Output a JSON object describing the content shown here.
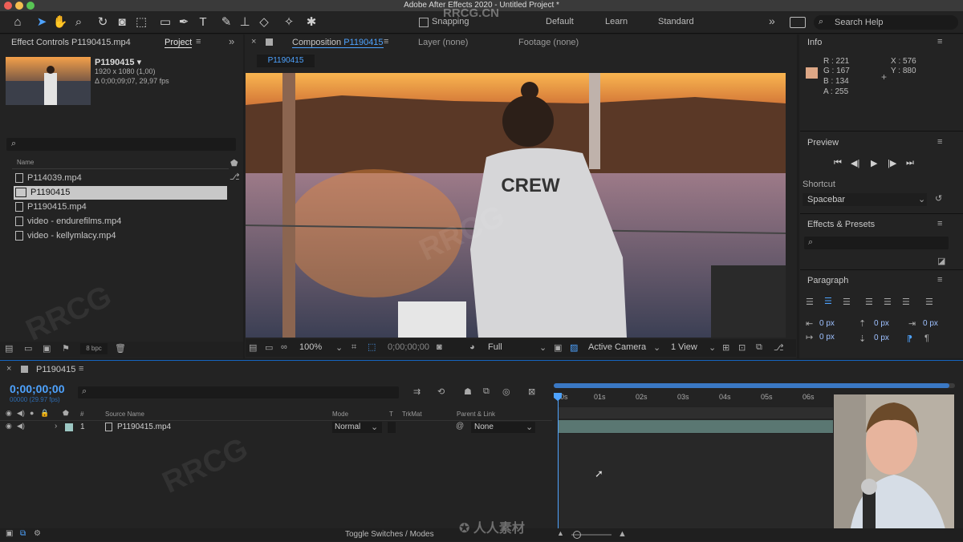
{
  "window": {
    "title": "Adobe After Effects 2020 - Untitled Project *"
  },
  "toolbar": {
    "snapping_label": "Snapping",
    "workspaces": [
      "Default",
      "Learn",
      "Standard"
    ],
    "search_placeholder": "Search Help"
  },
  "project_panel": {
    "tab_effect_controls": "Effect Controls P1190415.mp4",
    "tab_project": "Project",
    "selected": {
      "name": "P1190415 ▾",
      "dimensions": "1920 x 1080 (1,00)",
      "duration": "Δ 0;00;09;07, 29,97 fps"
    },
    "column_name": "Name",
    "items": [
      {
        "name": "P114039.mp4",
        "type": "footage"
      },
      {
        "name": "P1190415",
        "type": "composition"
      },
      {
        "name": "P1190415.mp4",
        "type": "footage"
      },
      {
        "name": "video - endurefilms.mp4",
        "type": "footage"
      },
      {
        "name": "video - kellymlacy.mp4",
        "type": "footage"
      }
    ],
    "bpc": "8 bpc"
  },
  "composition_panel": {
    "tab_composition_prefix": "Composition",
    "tab_composition_name": "P1190415",
    "tab_layer": "Layer (none)",
    "tab_footage": "Footage (none)",
    "comp_chip": "P1190415",
    "zoom": "100%",
    "timecode": "0;00;00;00",
    "resolution": "Full",
    "camera": "Active Camera",
    "views": "1 View",
    "shirt_text": "CREW"
  },
  "info_panel": {
    "title": "Info",
    "r": "R : 221",
    "g": "G : 167",
    "b": "B : 134",
    "a": "A : 255",
    "x": "X : 576",
    "y": "Y : 880",
    "swatch_color": "#dda786"
  },
  "preview_panel": {
    "title": "Preview",
    "shortcut_label": "Shortcut",
    "shortcut_value": "Spacebar"
  },
  "effects_panel": {
    "title": "Effects & Presets"
  },
  "paragraph_panel": {
    "title": "Paragraph",
    "indent_left": "0 px",
    "indent_first": "0 px",
    "indent_right": "0 px",
    "space_before": "0 px",
    "space_after": "0 px"
  },
  "timeline": {
    "comp_name": "P1190415",
    "timecode": "0;00;00;00",
    "frames": "00000 (29.97 fps)",
    "columns": {
      "hash": "#",
      "source_name": "Source Name",
      "mode": "Mode",
      "t": "T",
      "trkmat": "TrkMat",
      "parent": "Parent & Link"
    },
    "ruler": [
      "0s",
      "01s",
      "02s",
      "03s",
      "04s",
      "05s",
      "06s"
    ],
    "layer": {
      "index": "1",
      "name": "P1190415.mp4",
      "mode": "Normal",
      "parent": "None"
    },
    "footer": "Toggle Switches / Modes"
  },
  "watermark": {
    "text": "RRCG.CN",
    "site_logo": "人人素材",
    "tile_text": "RRCG"
  },
  "colors": {
    "accent_blue": "#2d8ceb",
    "timecode_blue": "#4ea3ff",
    "layer_bar": "#5a7772"
  }
}
